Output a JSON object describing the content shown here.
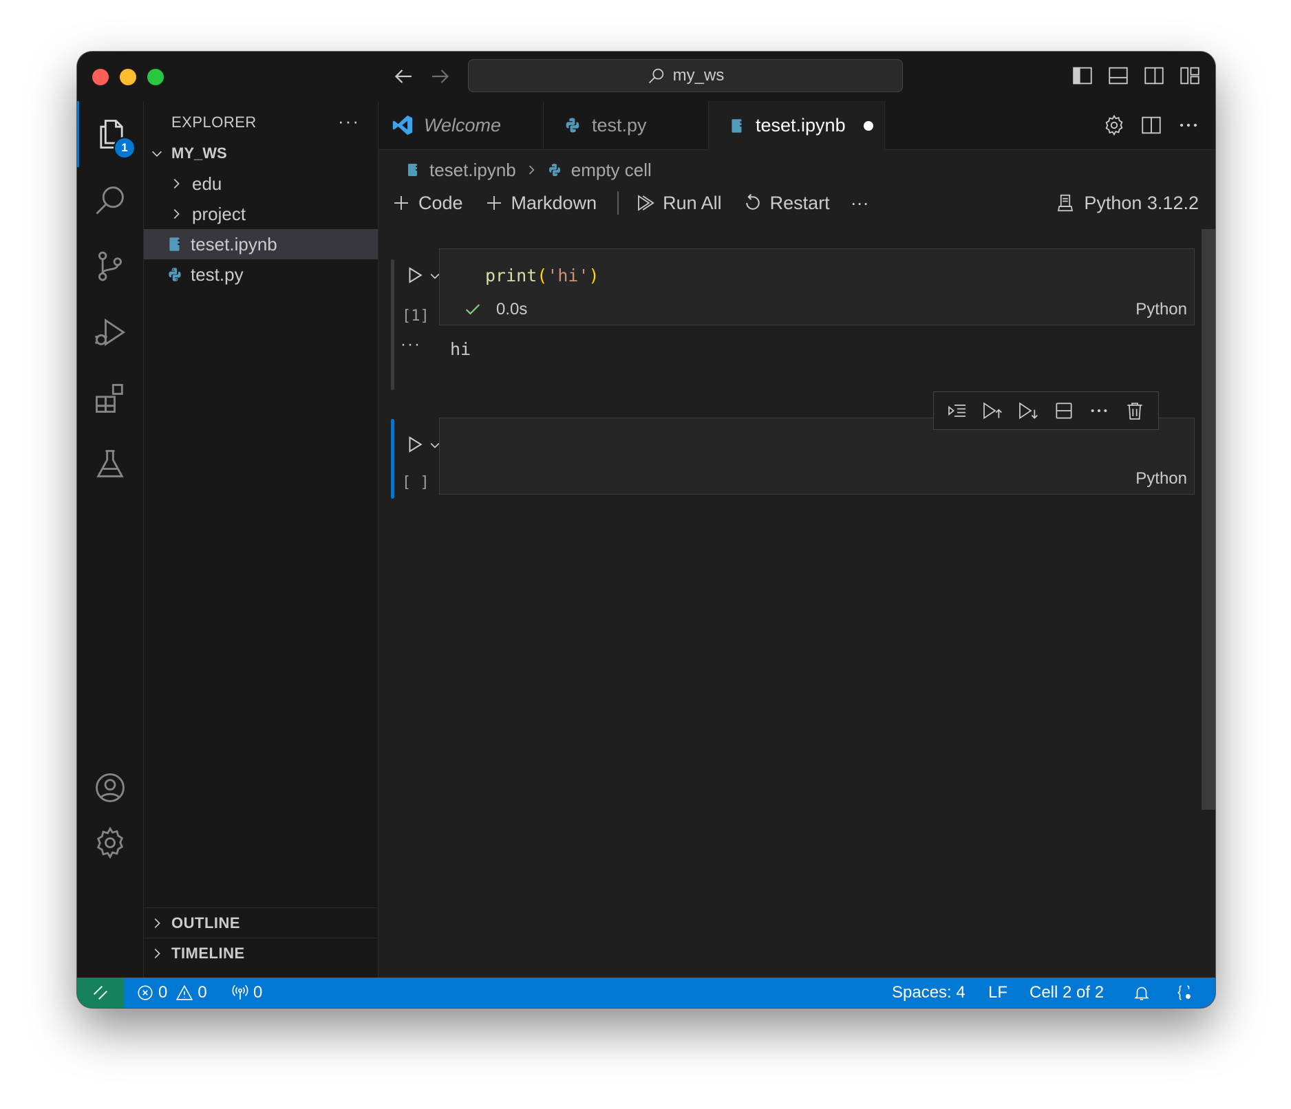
{
  "titlebar": {
    "search_text": "my_ws"
  },
  "activity": {
    "explorer_badge": "1"
  },
  "sidebar": {
    "title": "EXPLORER",
    "more": "···",
    "root": "MY_WS",
    "items": [
      {
        "label": "edu",
        "kind": "folder"
      },
      {
        "label": "project",
        "kind": "folder"
      },
      {
        "label": "teset.ipynb",
        "kind": "notebook"
      },
      {
        "label": "test.py",
        "kind": "python"
      }
    ],
    "sections": {
      "outline": "OUTLINE",
      "timeline": "TIMELINE"
    }
  },
  "tabs": [
    {
      "label": "Welcome",
      "icon": "vscode-icon"
    },
    {
      "label": "test.py",
      "icon": "python-icon"
    },
    {
      "label": "teset.ipynb",
      "icon": "notebook-icon",
      "active": true,
      "dirty": true
    }
  ],
  "breadcrumb": {
    "file": "teset.ipynb",
    "cell": "empty cell"
  },
  "toolbar": {
    "code": "Code",
    "markdown": "Markdown",
    "run_all": "Run All",
    "restart": "Restart",
    "more": "···",
    "kernel": "Python 3.12.2"
  },
  "cells": [
    {
      "exec_count": "[1]",
      "code_fn": "print",
      "code_open": "(",
      "code_str": "'hi'",
      "code_close": ")",
      "duration": "0.0s",
      "language": "Python",
      "output_more": "···",
      "output": "hi"
    },
    {
      "exec_count": "[ ]",
      "language": "Python"
    }
  ],
  "statusbar": {
    "errors": "0",
    "warnings": "0",
    "ports": "0",
    "spaces": "Spaces: 4",
    "eol": "LF",
    "cell_pos": "Cell 2 of 2"
  },
  "colors": {
    "accent": "#0078d4",
    "remote": "#16825d",
    "string": "#ce9178",
    "function": "#dcdcaa",
    "success": "#89d185"
  }
}
